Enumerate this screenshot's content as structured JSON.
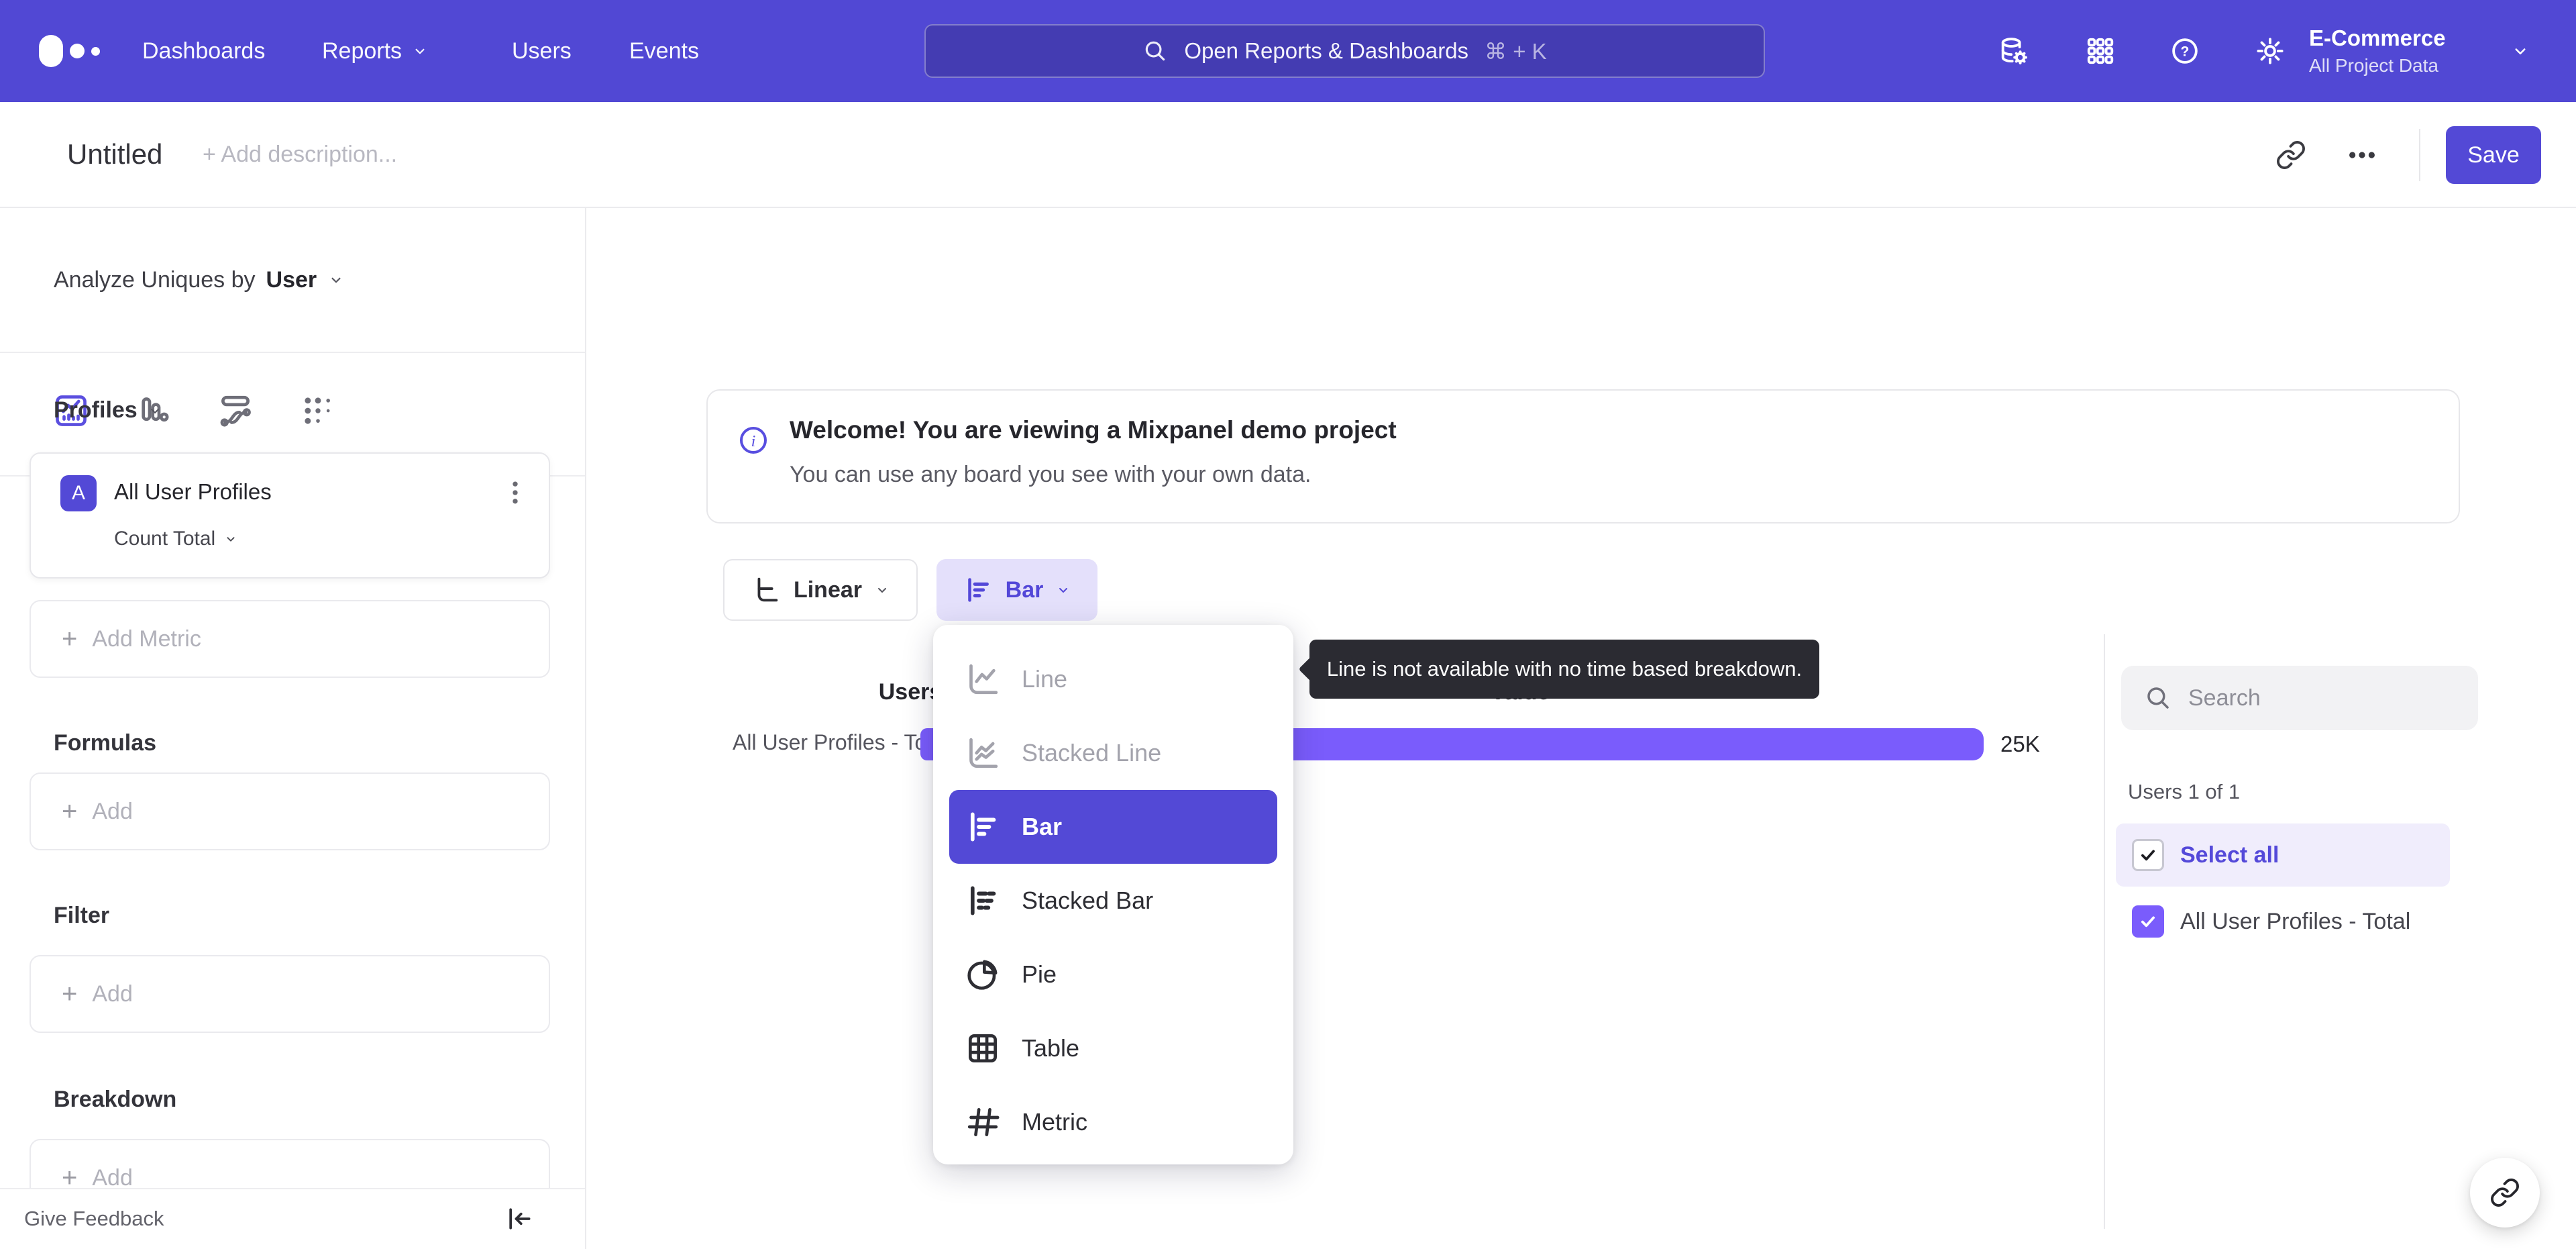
{
  "colors": {
    "nav_bg": "#5148D4",
    "accent": "#5349D6",
    "bar_fill": "#7A5CFC",
    "tooltip_bg": "#2B2B32",
    "selected_row_bg": "#F0EDFC"
  },
  "nav": {
    "links": [
      {
        "label": "Dashboards"
      },
      {
        "label": "Reports"
      },
      {
        "label": "Users"
      },
      {
        "label": "Events"
      }
    ],
    "search": {
      "placeholder": "Open Reports & Dashboards",
      "shortcut": "⌘ + K"
    },
    "project": {
      "name": "E-Commerce",
      "scope": "All Project Data"
    }
  },
  "header": {
    "title": "Untitled",
    "description_placeholder": "+ Add description...",
    "save_label": "Save"
  },
  "sidebar": {
    "analyze_prefix": "Analyze Uniques by",
    "analyze_value": "User",
    "profiles_label": "Profiles",
    "metric_card": {
      "badge": "A",
      "name": "All User Profiles",
      "aggregation": "Count Total"
    },
    "plus": "+",
    "add_metric_label": "Add Metric",
    "formulas_label": "Formulas",
    "filter_label": "Filter",
    "breakdown_label": "Breakdown",
    "add_label": "Add",
    "feedback_label": "Give Feedback"
  },
  "banner": {
    "title": "Welcome! You are viewing a Mixpanel demo project",
    "subtitle": "You can use any board you see with your own data."
  },
  "controls": {
    "scale_label": "Linear",
    "chart_type_label": "Bar"
  },
  "chart": {
    "columns": {
      "users": "Users",
      "value": "Value"
    },
    "row_label": "All User Profiles - Total",
    "value_label": "25K"
  },
  "chart_data": {
    "type": "bar",
    "orientation": "horizontal",
    "categories": [
      "All User Profiles - Total"
    ],
    "values": [
      25000
    ],
    "value_labels": [
      "25K"
    ],
    "columns": [
      "Users",
      "Value"
    ],
    "series_color": "#7A5CFC"
  },
  "dropdown": {
    "items": [
      {
        "label": "Line",
        "state": "disabled"
      },
      {
        "label": "Stacked Line",
        "state": "disabled"
      },
      {
        "label": "Bar",
        "state": "selected"
      },
      {
        "label": "Stacked Bar",
        "state": "normal"
      },
      {
        "label": "Pie",
        "state": "normal"
      },
      {
        "label": "Table",
        "state": "normal"
      },
      {
        "label": "Metric",
        "state": "normal"
      }
    ]
  },
  "tooltip": {
    "text": "Line is not available with no time based breakdown."
  },
  "legend": {
    "search_placeholder": "Search",
    "count_label": "Users 1 of 1",
    "select_all_label": "Select all",
    "rows": [
      {
        "label": "All User Profiles - Total",
        "checked": true
      }
    ]
  }
}
